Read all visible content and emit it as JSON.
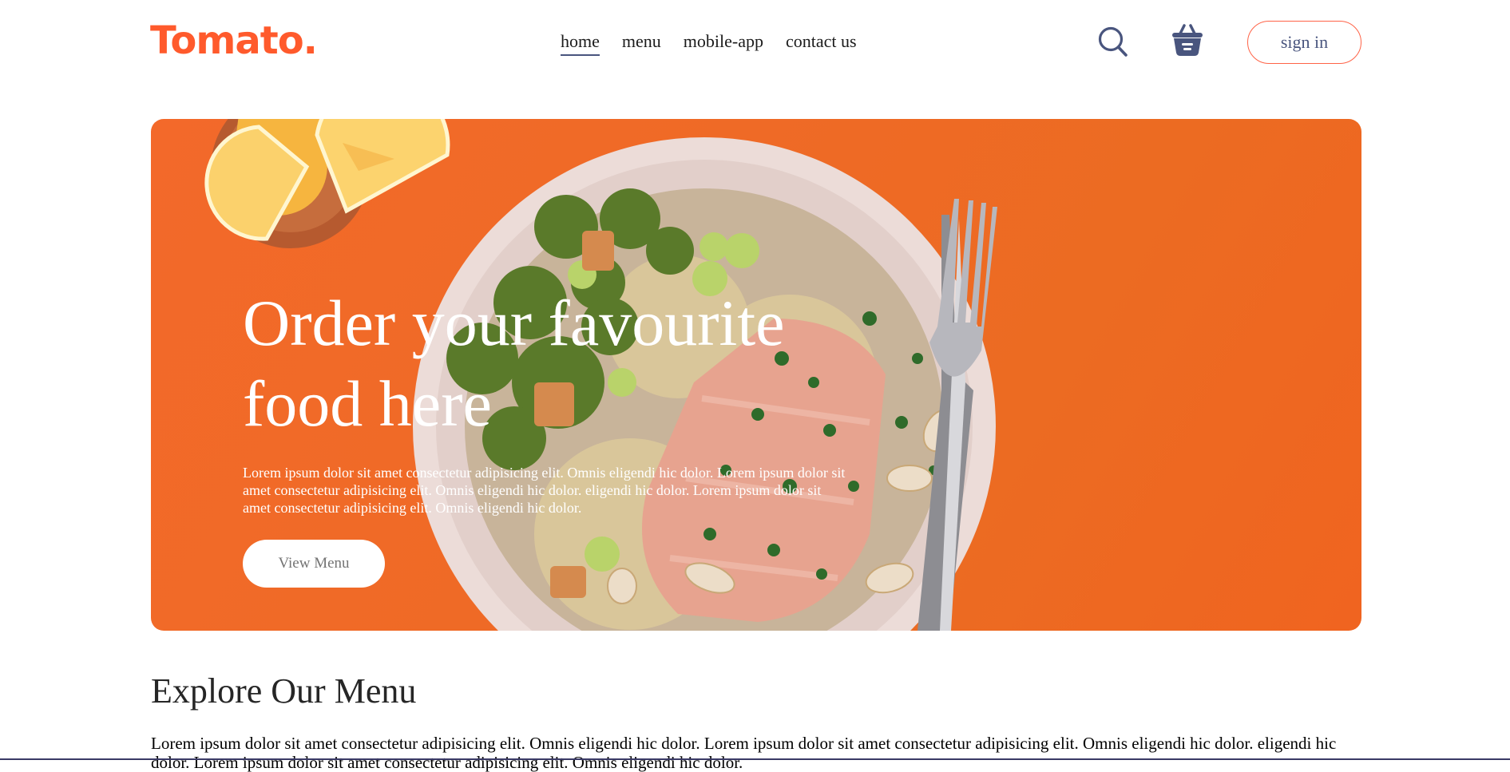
{
  "navbar": {
    "logo": "Tomato.",
    "links": [
      "home",
      "menu",
      "mobile-app",
      "contact us"
    ],
    "active_link": "home",
    "icons": [
      "search-icon",
      "basket-icon"
    ],
    "signin_label": "sign in"
  },
  "hero": {
    "title": "Order your favourite food here",
    "description": "Lorem ipsum dolor sit amet consectetur adipisicing elit. Omnis eligendi hic dolor. Lorem ipsum dolor sit amet consectetur adipisicing elit. Omnis eligendi hic dolor. eligendi hic dolor. Lorem ipsum dolor sit amet consectetur adipisicing elit. Omnis eligendi hic dolor.",
    "button_label": "View Menu"
  },
  "explore": {
    "title": "Explore Our Menu",
    "text": "Lorem ipsum dolor sit amet consectetur adipisicing elit. Omnis eligendi hic dolor. Lorem ipsum dolor sit amet consectetur adipisicing elit. Omnis eligendi hic dolor. eligendi hic dolor. Lorem ipsum dolor sit amet consectetur adipisicing elit. Omnis eligendi hic dolor."
  },
  "colors": {
    "brand": "#ff5a2c",
    "hero_background": "#ef6a26",
    "nav_text": "#49557e",
    "signin_border": "#ff6347"
  }
}
